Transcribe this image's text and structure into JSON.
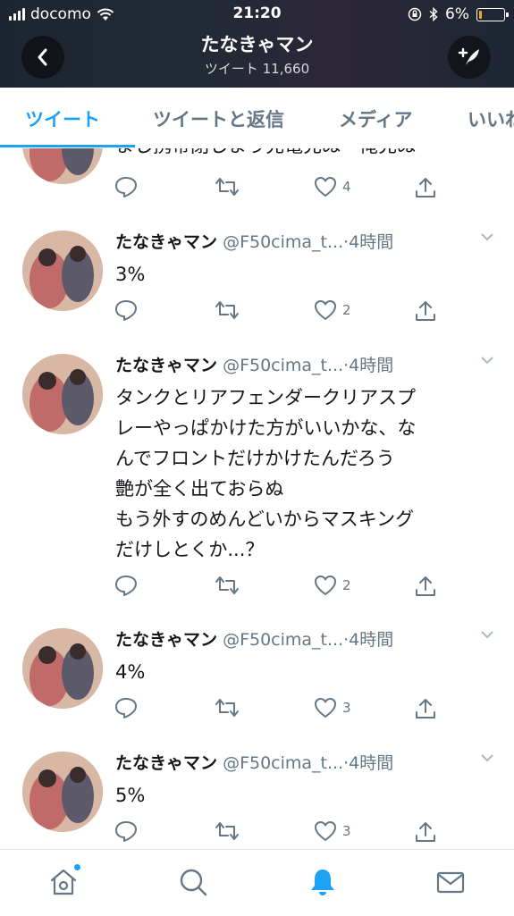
{
  "status_bar": {
    "carrier": "docomo",
    "time": "21:20",
    "battery_percent": "6%",
    "battery_level": 0.06,
    "icons": [
      "signal-icon",
      "wifi-icon",
      "orientation-lock-icon",
      "bluetooth-icon",
      "battery-icon"
    ]
  },
  "header": {
    "title": "たなきゃマン",
    "subtitle": "ツイート 11,660",
    "back_icon": "chevron-left-icon",
    "compose_icon": "compose-tweet-icon"
  },
  "tabs": [
    {
      "label": "ツイート",
      "active": true
    },
    {
      "label": "ツイートと返信",
      "active": false
    },
    {
      "label": "メディア",
      "active": false
    },
    {
      "label": "いいね",
      "active": false
    }
  ],
  "tweets": [
    {
      "name": "",
      "handle": "",
      "time": "",
      "text": "まし携帯閉しまう充電充ぬ一俺充ぬ",
      "replies": "",
      "retweets": "",
      "likes": "4"
    },
    {
      "name": "たなきゃマン",
      "handle": "@F50cima_t...",
      "time": "·4時間",
      "text": "3%",
      "replies": "",
      "retweets": "",
      "likes": "2"
    },
    {
      "name": "たなきゃマン",
      "handle": "@F50cima_t...",
      "time": "·4時間",
      "text_lines": [
        "タンクとリアフェンダークリアスプ",
        "レーやっぱかけた方がいいかな、な",
        "んでフロントだけかけたんだろう",
        "艶が全く出ておらぬ",
        "もう外すのめんどいからマスキング",
        "だけしとくか...？"
      ],
      "replies": "",
      "retweets": "",
      "likes": "2"
    },
    {
      "name": "たなきゃマン",
      "handle": "@F50cima_t...",
      "time": "·4時間",
      "text": "4%",
      "replies": "",
      "retweets": "",
      "likes": "3"
    },
    {
      "name": "たなきゃマン",
      "handle": "@F50cima_t...",
      "time": "·4時間",
      "text": "5%",
      "replies": "",
      "retweets": "",
      "likes": "3"
    }
  ],
  "bottom_nav": [
    {
      "name": "home",
      "icon": "home-icon",
      "active": false,
      "badge": true
    },
    {
      "name": "search",
      "icon": "search-icon",
      "active": false
    },
    {
      "name": "notifications",
      "icon": "bell-icon",
      "active": true
    },
    {
      "name": "messages",
      "icon": "envelope-icon",
      "active": false
    }
  ],
  "colors": {
    "accent": "#1da1f2",
    "text": "#14171a",
    "secondary": "#657786",
    "border": "#e1e8ed",
    "header_bg": "#222a36",
    "battery_low": "#f5a623"
  }
}
